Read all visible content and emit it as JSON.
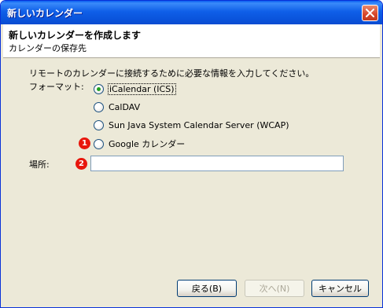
{
  "window": {
    "title": "新しいカレンダー"
  },
  "header": {
    "title": "新しいカレンダーを作成します",
    "subtitle": "カレンダーの保存先"
  },
  "form": {
    "description": "リモートのカレンダーに接続するために必要な情報を入力してください。",
    "format_label": "フォーマット:",
    "options": [
      {
        "label": "iCalendar (ICS)",
        "selected": true
      },
      {
        "label": "CalDAV",
        "selected": false
      },
      {
        "label": "Sun Java System Calendar Server (WCAP)",
        "selected": false
      },
      {
        "label": "Google カレンダー",
        "selected": false
      }
    ],
    "location_label": "場所:",
    "location_value": ""
  },
  "annotations": {
    "marker_1": "1",
    "marker_2": "2",
    "color": "#e8160c"
  },
  "buttons": {
    "back": "戻る(B)",
    "next": "次へ(N)",
    "cancel": "キャンセル"
  }
}
